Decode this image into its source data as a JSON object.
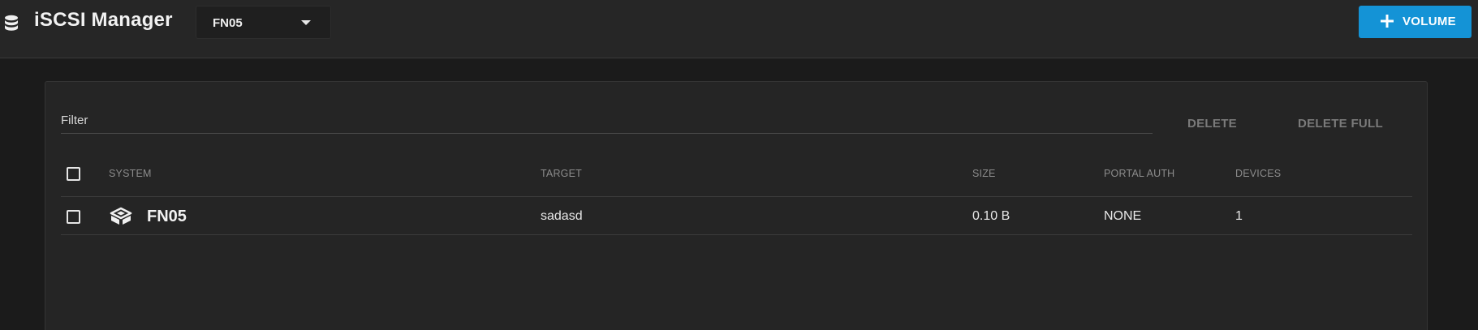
{
  "header": {
    "title": "iSCSI Manager",
    "app_icon": "database-icon",
    "system_selector": {
      "value": "FN05"
    },
    "volume_button": {
      "label": "VOLUME",
      "icon": "plus-icon"
    }
  },
  "toolbar": {
    "filter_label": "Filter",
    "delete_label": "DELETE",
    "delete_full_label": "DELETE FULL"
  },
  "table": {
    "columns": [
      "SYSTEM",
      "TARGET",
      "SIZE",
      "PORTAL AUTH",
      "DEVICES"
    ],
    "rows": [
      {
        "system": "FN05",
        "system_icon": "truenas-logo-icon",
        "target": "sadasd",
        "size": "0.10 B",
        "portal_auth": "NONE",
        "devices": "1"
      }
    ]
  },
  "colors": {
    "accent": "#1493d6",
    "background": "#1b1b1b",
    "panel": "#252525"
  }
}
